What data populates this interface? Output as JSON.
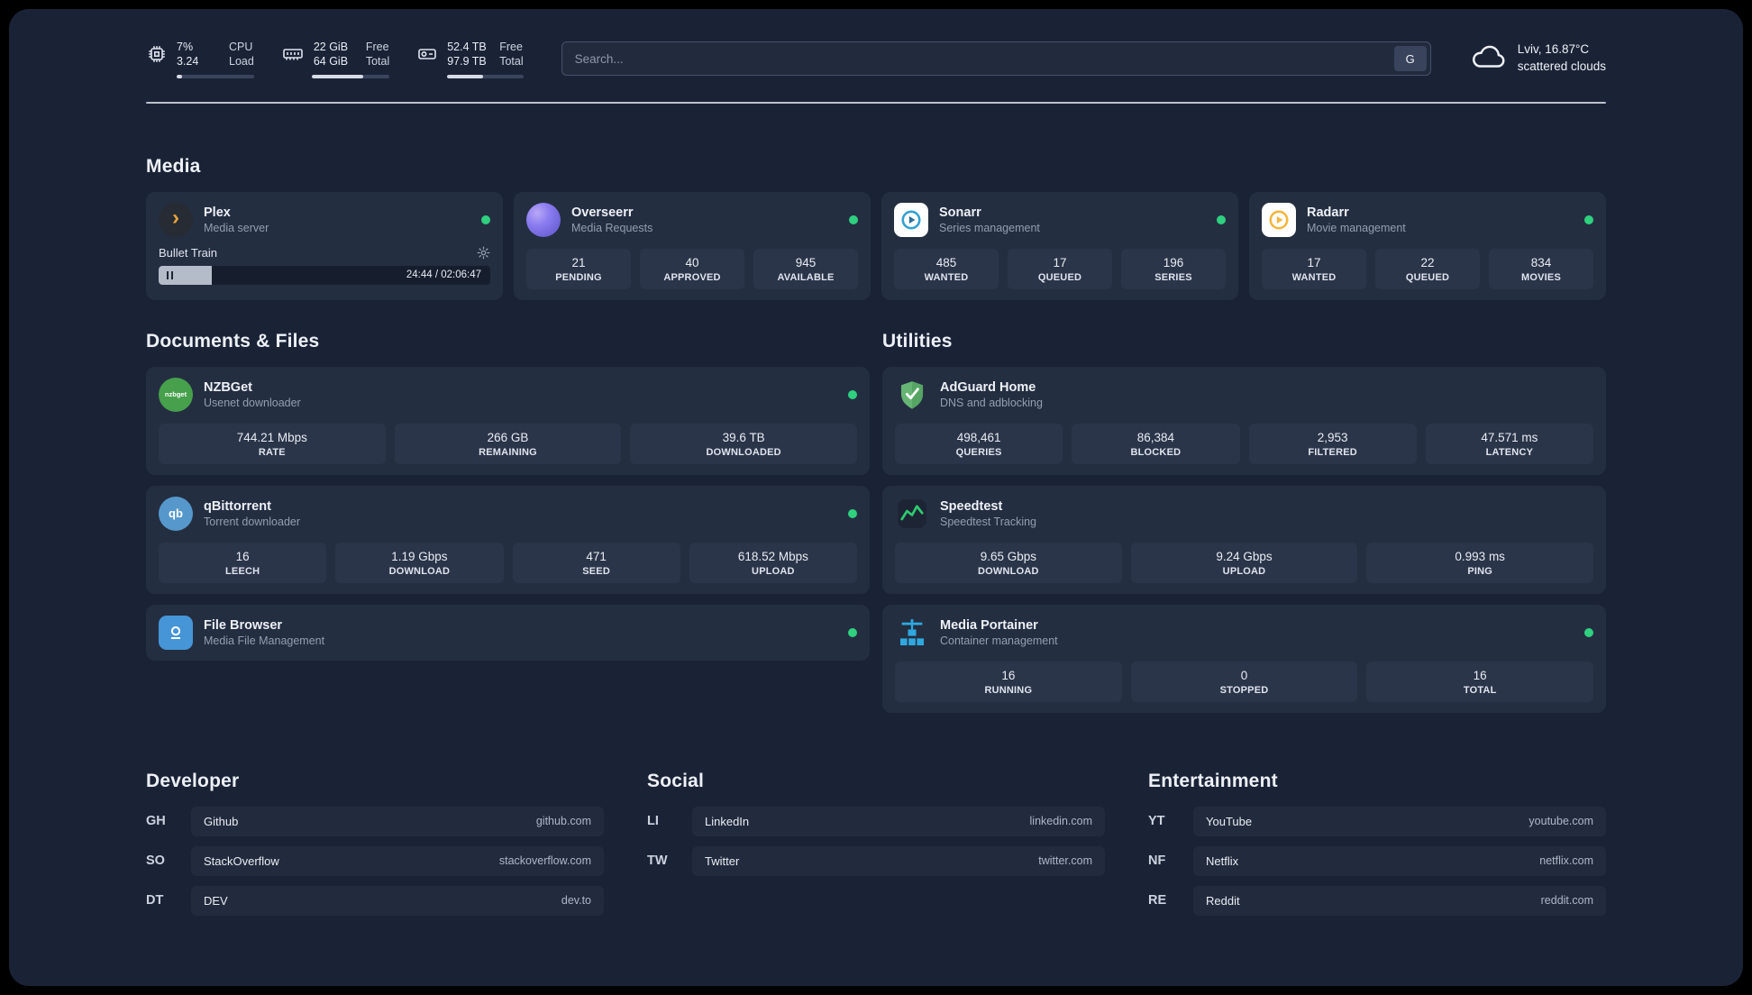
{
  "colors": {
    "background": "#1a2336",
    "card": "#242e41",
    "tile": "#2b3549",
    "status_online": "#2fd07f"
  },
  "topbar": {
    "cpu": {
      "value_top": "7%",
      "value_bottom": "3.24",
      "label_top": "CPU",
      "label_bottom": "Load",
      "bar_percent": 7
    },
    "ram": {
      "value_top": "22 GiB",
      "value_bottom": "64 GiB",
      "label_top": "Free",
      "label_bottom": "Total",
      "bar_percent": 66
    },
    "disk": {
      "value_top": "52.4 TB",
      "value_bottom": "97.9 TB",
      "label_top": "Free",
      "label_bottom": "Total",
      "bar_percent": 47
    },
    "search": {
      "placeholder": "Search...",
      "button_label": "G"
    },
    "weather": {
      "location": "Lviv, 16.87°C",
      "condition": "scattered clouds"
    }
  },
  "sections": {
    "media": {
      "title": "Media",
      "plex": {
        "name": "Plex",
        "subtitle": "Media server",
        "status": "online",
        "now_playing": "Bullet Train",
        "elapsed_total": "24:44 / 02:06:47",
        "progress_percent": 16
      },
      "overseerr": {
        "name": "Overseerr",
        "subtitle": "Media Requests",
        "status": "online",
        "stats": [
          {
            "value": "21",
            "label": "PENDING"
          },
          {
            "value": "40",
            "label": "APPROVED"
          },
          {
            "value": "945",
            "label": "AVAILABLE"
          }
        ]
      },
      "sonarr": {
        "name": "Sonarr",
        "subtitle": "Series management",
        "status": "online",
        "stats": [
          {
            "value": "485",
            "label": "WANTED"
          },
          {
            "value": "17",
            "label": "QUEUED"
          },
          {
            "value": "196",
            "label": "SERIES"
          }
        ]
      },
      "radarr": {
        "name": "Radarr",
        "subtitle": "Movie management",
        "status": "online",
        "stats": [
          {
            "value": "17",
            "label": "WANTED"
          },
          {
            "value": "22",
            "label": "QUEUED"
          },
          {
            "value": "834",
            "label": "MOVIES"
          }
        ]
      }
    },
    "documents": {
      "title": "Documents & Files",
      "nzbget": {
        "name": "NZBGet",
        "subtitle": "Usenet downloader",
        "status": "online",
        "stats": [
          {
            "value": "744.21 Mbps",
            "label": "RATE"
          },
          {
            "value": "266 GB",
            "label": "REMAINING"
          },
          {
            "value": "39.6 TB",
            "label": "DOWNLOADED"
          }
        ]
      },
      "qbittorrent": {
        "name": "qBittorrent",
        "subtitle": "Torrent downloader",
        "status": "online",
        "stats": [
          {
            "value": "16",
            "label": "LEECH"
          },
          {
            "value": "1.19 Gbps",
            "label": "DOWNLOAD"
          },
          {
            "value": "471",
            "label": "SEED"
          },
          {
            "value": "618.52 Mbps",
            "label": "UPLOAD"
          }
        ]
      },
      "filebrowser": {
        "name": "File Browser",
        "subtitle": "Media File Management",
        "status": "online"
      }
    },
    "utilities": {
      "title": "Utilities",
      "adguard": {
        "name": "AdGuard Home",
        "subtitle": "DNS and adblocking",
        "stats": [
          {
            "value": "498,461",
            "label": "QUERIES"
          },
          {
            "value": "86,384",
            "label": "BLOCKED"
          },
          {
            "value": "2,953",
            "label": "FILTERED"
          },
          {
            "value": "47.571 ms",
            "label": "LATENCY"
          }
        ]
      },
      "speedtest": {
        "name": "Speedtest",
        "subtitle": "Speedtest Tracking",
        "stats": [
          {
            "value": "9.65 Gbps",
            "label": "DOWNLOAD"
          },
          {
            "value": "9.24 Gbps",
            "label": "UPLOAD"
          },
          {
            "value": "0.993 ms",
            "label": "PING"
          }
        ]
      },
      "portainer": {
        "name": "Media Portainer",
        "subtitle": "Container management",
        "status": "online",
        "stats": [
          {
            "value": "16",
            "label": "RUNNING"
          },
          {
            "value": "0",
            "label": "STOPPED"
          },
          {
            "value": "16",
            "label": "TOTAL"
          }
        ]
      }
    }
  },
  "bookmarks": {
    "developer": {
      "title": "Developer",
      "items": [
        {
          "abbr": "GH",
          "name": "Github",
          "url": "github.com"
        },
        {
          "abbr": "SO",
          "name": "StackOverflow",
          "url": "stackoverflow.com"
        },
        {
          "abbr": "DT",
          "name": "DEV",
          "url": "dev.to"
        }
      ]
    },
    "social": {
      "title": "Social",
      "items": [
        {
          "abbr": "LI",
          "name": "LinkedIn",
          "url": "linkedin.com"
        },
        {
          "abbr": "TW",
          "name": "Twitter",
          "url": "twitter.com"
        }
      ]
    },
    "entertainment": {
      "title": "Entertainment",
      "items": [
        {
          "abbr": "YT",
          "name": "YouTube",
          "url": "youtube.com"
        },
        {
          "abbr": "NF",
          "name": "Netflix",
          "url": "netflix.com"
        },
        {
          "abbr": "RE",
          "name": "Reddit",
          "url": "reddit.com"
        }
      ]
    }
  }
}
